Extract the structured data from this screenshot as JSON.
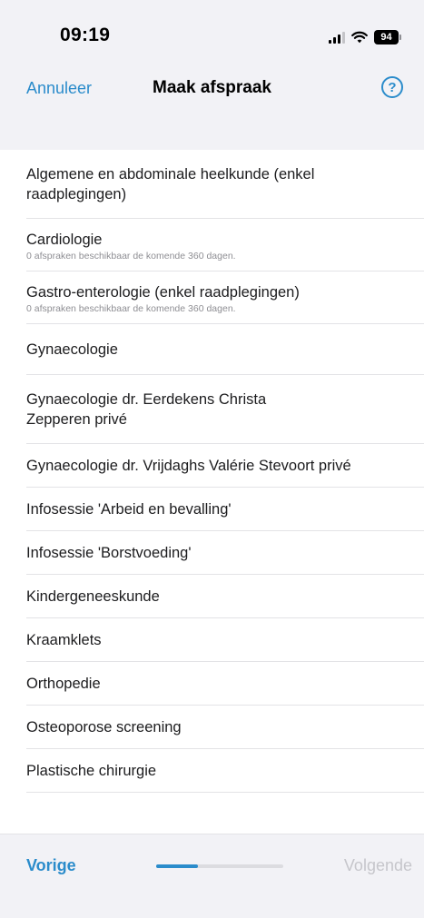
{
  "status_bar": {
    "time": "09:19",
    "battery": "94",
    "signal_icon": "signal-icon",
    "wifi_icon": "wifi-icon"
  },
  "nav": {
    "cancel_label": "Annuleer",
    "title": "Maak afspraak",
    "help_icon": "question-circle-icon",
    "help_glyph": "?"
  },
  "items": [
    {
      "title": "Algemene en abdominale heelkunde (enkel raadplegingen)",
      "subtitle": ""
    },
    {
      "title": "Cardiologie",
      "subtitle": "0 afspraken beschikbaar de komende 360 dagen."
    },
    {
      "title": "Gastro-enterologie (enkel raadplegingen)",
      "subtitle": "0 afspraken beschikbaar de komende 360 dagen."
    },
    {
      "title": "Gynaecologie",
      "subtitle": ""
    },
    {
      "title": "Gynaecologie dr. Eerdekens Christa Zepperen privé",
      "subtitle": ""
    },
    {
      "title": "Gynaecologie dr. Vrijdaghs Valérie Stevoort privé",
      "subtitle": ""
    },
    {
      "title": "Infosessie 'Arbeid en bevalling'",
      "subtitle": ""
    },
    {
      "title": "Infosessie 'Borstvoeding'",
      "subtitle": ""
    },
    {
      "title": "Kindergeneeskunde",
      "subtitle": ""
    },
    {
      "title": "Kraamklets",
      "subtitle": ""
    },
    {
      "title": "Orthopedie",
      "subtitle": ""
    },
    {
      "title": "Osteoporose screening",
      "subtitle": ""
    },
    {
      "title": "Plastische chirurgie",
      "subtitle": ""
    }
  ],
  "footer": {
    "prev_label": "Vorige",
    "next_label": "Volgende",
    "progress": 0.33
  },
  "colors": {
    "accent": "#2b8ccb",
    "disabled": "#c6c6cb",
    "background": "#f2f2f6"
  }
}
